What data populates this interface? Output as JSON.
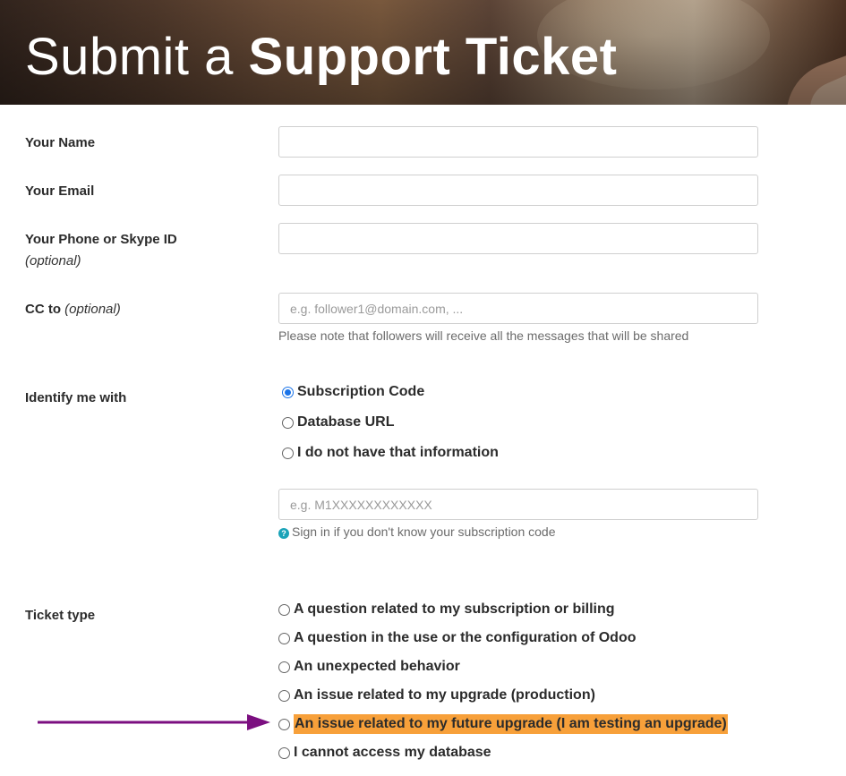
{
  "header": {
    "title_light": "Submit a",
    "title_bold": "Support Ticket"
  },
  "form": {
    "name": {
      "label": "Your Name",
      "value": ""
    },
    "email": {
      "label": "Your Email",
      "value": ""
    },
    "phone": {
      "label": "Your Phone or Skype ID",
      "optional": "(optional)",
      "value": ""
    },
    "cc": {
      "label": "CC to",
      "optional": "(optional)",
      "placeholder": "e.g. follower1@domain.com, ...",
      "help": "Please note that followers will receive all the messages that will be shared"
    },
    "identify": {
      "label": "Identify me with",
      "options": [
        {
          "label": "Subscription Code",
          "checked": true
        },
        {
          "label": "Database URL",
          "checked": false
        },
        {
          "label": "I do not have that information",
          "checked": false
        }
      ],
      "placeholder": "e.g. M1XXXXXXXXXXXX",
      "help": "Sign in if you don't know your subscription code"
    },
    "ticket_type": {
      "label": "Ticket type",
      "options": [
        {
          "label": "A question related to my subscription or billing",
          "checked": false
        },
        {
          "label": "A question in the use or the configuration of Odoo",
          "checked": false
        },
        {
          "label": "An unexpected behavior",
          "checked": false
        },
        {
          "label": "An issue related to my upgrade (production)",
          "checked": false
        },
        {
          "label": "An issue related to my future upgrade (I am testing an upgrade)",
          "checked": false,
          "highlighted": true
        },
        {
          "label": "I cannot access my database",
          "checked": false
        }
      ]
    }
  },
  "colors": {
    "highlight": "#f7a03a",
    "annotation_arrow": "#7b0f80",
    "radio_checked": "#1a73e8",
    "help_icon": "#1aa3b8"
  }
}
